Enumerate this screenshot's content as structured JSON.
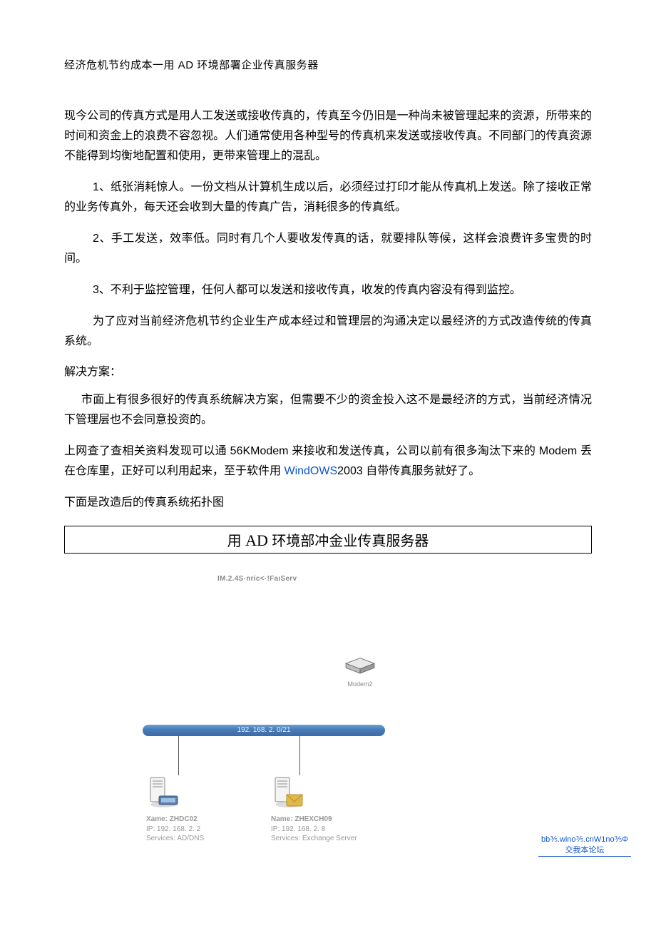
{
  "titleLine": {
    "prefix": "经济危机节约成本一用",
    "ad": " AD ",
    "suffix": "环境部署企业传真服务器"
  },
  "paragraphs": {
    "intro": "现今公司的传真方式是用人工发送或接收传真的，传真至今仍旧是一种尚未被管理起来的资源，所带来的时间和资金上的浪费不容忽视。人们通常使用各种型号的传真机来发送或接收传真。不同部门的传真资源不能得到均衡地配置和使用，更带来管理上的混乱。",
    "p1_num": "1",
    "p1": "、纸张消耗惊人。一份文档从计算机生成以后，必须经过打印才能从传真机上发送。除了接收正常的业务传真外，每天还会收到大量的传真广告，消耗很多的传真纸。",
    "p2_num": "2",
    "p2": "、手工发送，效率低。同时有几个人要收发传真的话，就要排队等候，这样会浪费许多宝贵的时间。",
    "p3_num": "3",
    "p3": "、不利于监控管理，任何人都可以发送和接收传真，收发的传真内容没有得到监控。",
    "p4": "为了应对当前经济危机节约企业生产成本经过和管理层的沟通决定以最经济的方式改造传统的传真系统。",
    "solution_label": "解决方案：",
    "p5": "市面上有很多很好的传真系统解决方案，但需要不少的资金投入这不是最经济的方式，当前经济情况下管理层也不会同意投资的。",
    "p6_a": "上网查了查相关资料发现可以通",
    "p6_modem": " 56KModem ",
    "p6_b": "来接收和发送传真，公司以前有很多淘汰下来的",
    "p6_modem2": " Modem ",
    "p6_c": "丢在仓库里，正好可以利用起来，至于软件用",
    "p6_link": " WindOWS",
    "p6_year": "2003 ",
    "p6_d": "自带传真服务就好了。",
    "p7": "下面是改造后的传真系统拓扑图"
  },
  "box": {
    "pre": "用",
    "ad": " AD ",
    "post": "环境部冲金业传真服务器"
  },
  "diagram": {
    "topLabel": "IM.2.4S·nric<·!FaıServ",
    "modemLabel": "Modem2",
    "switchText": "192. 168. 2. 0/21",
    "server1": {
      "name": "Xame: ZHDC02",
      "ip": "IP: 192. 168. 2. 2",
      "svc": "Services: AD/DNS"
    },
    "server2": {
      "name": "Name: ZHEXCH09",
      "ip": "IP: 192. 168. 2. 8",
      "svc": "Services: Exchange Server"
    }
  },
  "cornerLink": "bb⅗.wino⅗.cnW1no⅗Φ 交我本论坛"
}
